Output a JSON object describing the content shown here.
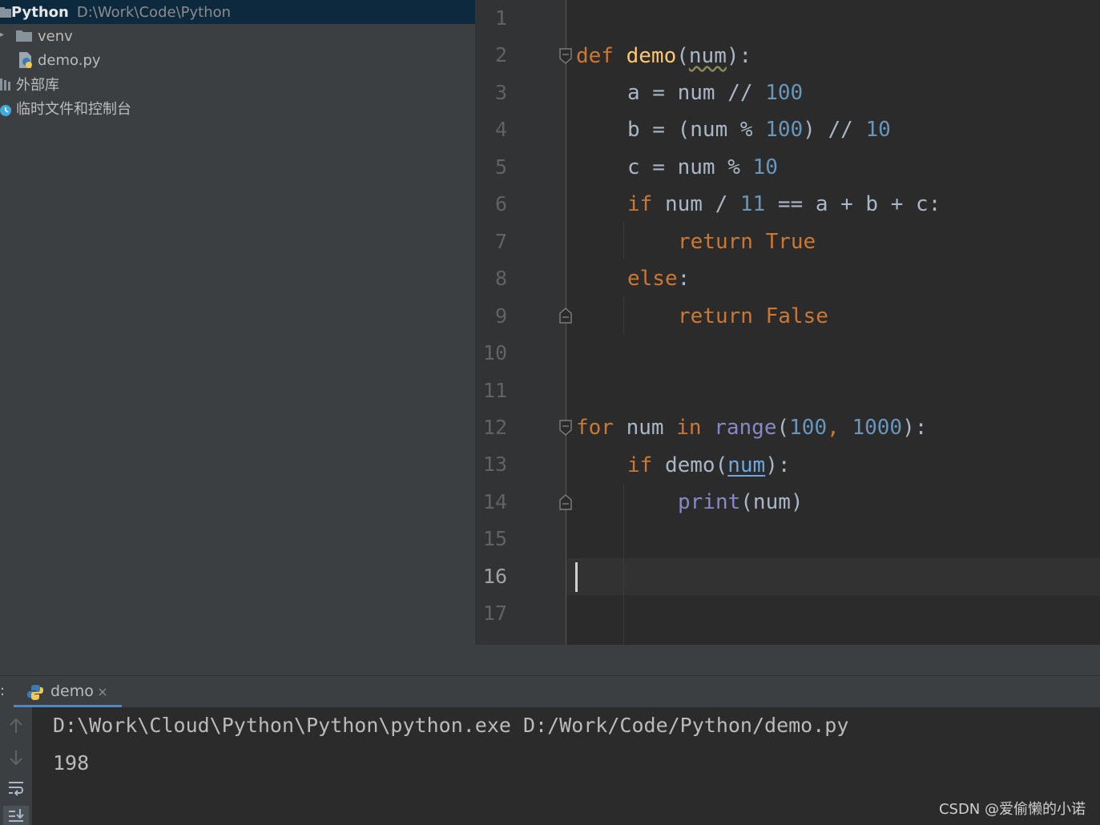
{
  "project": {
    "root_name": "Python",
    "root_path": "D:\\Work\\Code\\Python",
    "items": [
      {
        "label": "venv"
      },
      {
        "label": "demo.py"
      },
      {
        "label": "外部库"
      },
      {
        "label": "临时文件和控制台"
      }
    ]
  },
  "editor": {
    "line_numbers": [
      "1",
      "2",
      "3",
      "4",
      "5",
      "6",
      "7",
      "8",
      "9",
      "10",
      "11",
      "12",
      "13",
      "14",
      "15",
      "16",
      "17"
    ],
    "current_line": 16,
    "code_tokens": {
      "l2_def": "def",
      "l2_name": "demo",
      "l2_open": "(",
      "l2_param": "num",
      "l2_close": "):",
      "l3_a": "a = num // ",
      "l3_n": "100",
      "l4_a": "b = (num % ",
      "l4_n1": "100",
      "l4_b": ") // ",
      "l4_n2": "10",
      "l5_a": "c = num % ",
      "l5_n": "10",
      "l6_if": "if",
      "l6_a": " num / ",
      "l6_n": "11",
      "l6_b": " == a + b + c:",
      "l7_ret": "return",
      "l7_val": " True",
      "l8_else": "else",
      "l8_colon": ":",
      "l9_ret": "return",
      "l9_val": " False",
      "l12_for": "for",
      "l12_a": " num ",
      "l12_in": "in",
      "l12_sp": " ",
      "l12_range": "range",
      "l12_open": "(",
      "l12_n1": "100",
      "l12_comma": ", ",
      "l12_n2": "1000",
      "l12_close": "):",
      "l13_if": "if",
      "l13_a": " demo(",
      "l13_ref": "num",
      "l13_close": "):",
      "l14_print": "print",
      "l14_args": "(num)"
    }
  },
  "run": {
    "panel_prefix": ":",
    "tab_label": "demo",
    "output_lines": [
      "D:\\Work\\Cloud\\Python\\Python\\python.exe D:/Work/Code/Python/demo.py",
      "198"
    ]
  },
  "watermark": "CSDN @爱偷懒的小诺",
  "colors": {
    "keyword": "#cc7832",
    "function": "#ffc66d",
    "number": "#6897bb",
    "builtin": "#8888c6",
    "text": "#a9b7c6",
    "selection": "#0d293e"
  }
}
